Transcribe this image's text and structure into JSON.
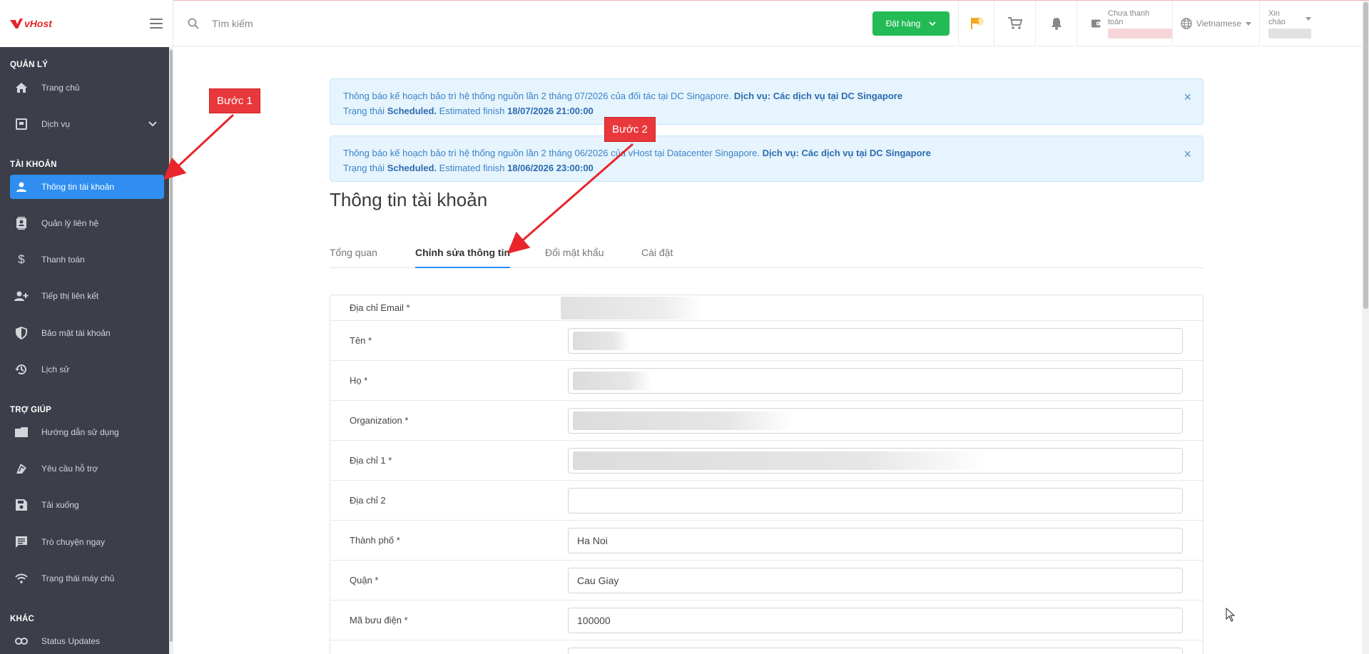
{
  "brand": {
    "logo": "vHost"
  },
  "sidebar": {
    "sections": {
      "manage": "QUẢN LÝ",
      "account": "TÀI KHOẢN",
      "help": "TRỢ GIÚP",
      "other": "KHÁC"
    },
    "items": [
      {
        "label": "Trang chủ",
        "icon": "home-icon"
      },
      {
        "label": "Dịch vụ",
        "icon": "services-icon"
      },
      {
        "label": "Thông tin tài khoản",
        "icon": "user-icon"
      },
      {
        "label": "Quản lý liên hệ",
        "icon": "contacts-icon"
      },
      {
        "label": "Thanh toán",
        "icon": "dollar-icon"
      },
      {
        "label": "Tiếp thị liên kết",
        "icon": "affiliate-icon"
      },
      {
        "label": "Bảo mật tài khoản",
        "icon": "shield-icon"
      },
      {
        "label": "Lịch sử",
        "icon": "history-icon"
      },
      {
        "label": "Hướng dẫn sử dụng",
        "icon": "guide-icon"
      },
      {
        "label": "Yêu cầu hỗ trợ",
        "icon": "support-icon"
      },
      {
        "label": "Tải xuống",
        "icon": "download-icon"
      },
      {
        "label": "Trò chuyện ngay",
        "icon": "chat-icon"
      },
      {
        "label": "Trạng thái máy chủ",
        "icon": "server-status-icon"
      },
      {
        "label": "Status Updates",
        "icon": "link-icon"
      }
    ]
  },
  "header": {
    "search_placeholder": "Tìm kiếm",
    "order_label": "Đặt hàng",
    "unpaid_label": "Chưa thanh toán",
    "language": "Vietnamese",
    "greeting": "Xin chào"
  },
  "alerts": [
    {
      "line1_prefix": "Thông báo kế hoạch bảo trì hệ thống nguồn lần 2 tháng 07/2026 của đối tác tại DC Singapore.",
      "line1_bold": "Dịch vụ: Các dịch vụ tại DC Singapore",
      "status_label": "Trạng thái",
      "status_value": "Scheduled.",
      "finish_label": "Estimated finish",
      "finish_value": "18/07/2026 21:00:00"
    },
    {
      "line1_prefix": "Thông báo kế hoạch bảo trì hệ thống nguồn lần 2 tháng 06/2026 của vHost tại Datacenter Singapore.",
      "line1_bold": "Dịch vụ: Các dịch vụ tại DC Singapore",
      "status_label": "Trạng thái",
      "status_value": "Scheduled.",
      "finish_label": "Estimated finish",
      "finish_value": "18/06/2026 23:00:00"
    }
  ],
  "page": {
    "title": "Thông tin tài khoản",
    "tabs": [
      "Tổng quan",
      "Chỉnh sửa thông tin",
      "Đổi mật khẩu",
      "Cài đặt"
    ]
  },
  "form": {
    "fields": [
      {
        "label": "Địa chỉ Email *",
        "value": ""
      },
      {
        "label": "Tên *",
        "value": ""
      },
      {
        "label": "Họ *",
        "value": ""
      },
      {
        "label": "Organization *",
        "value": ""
      },
      {
        "label": "Địa chỉ 1 *",
        "value": ""
      },
      {
        "label": "Địa chỉ 2",
        "value": ""
      },
      {
        "label": "Thành phố *",
        "value": "Ha Noi"
      },
      {
        "label": "Quận *",
        "value": "Cau Giay"
      },
      {
        "label": "Mã bưu điện *",
        "value": "100000"
      }
    ]
  },
  "annotations": {
    "step1": "Bước 1",
    "step2": "Bước 2"
  },
  "colors": {
    "accent": "#2f8ef0",
    "order": "#22bb55",
    "sidebar": "#3c3f4a",
    "annotation": "#e8383c"
  }
}
